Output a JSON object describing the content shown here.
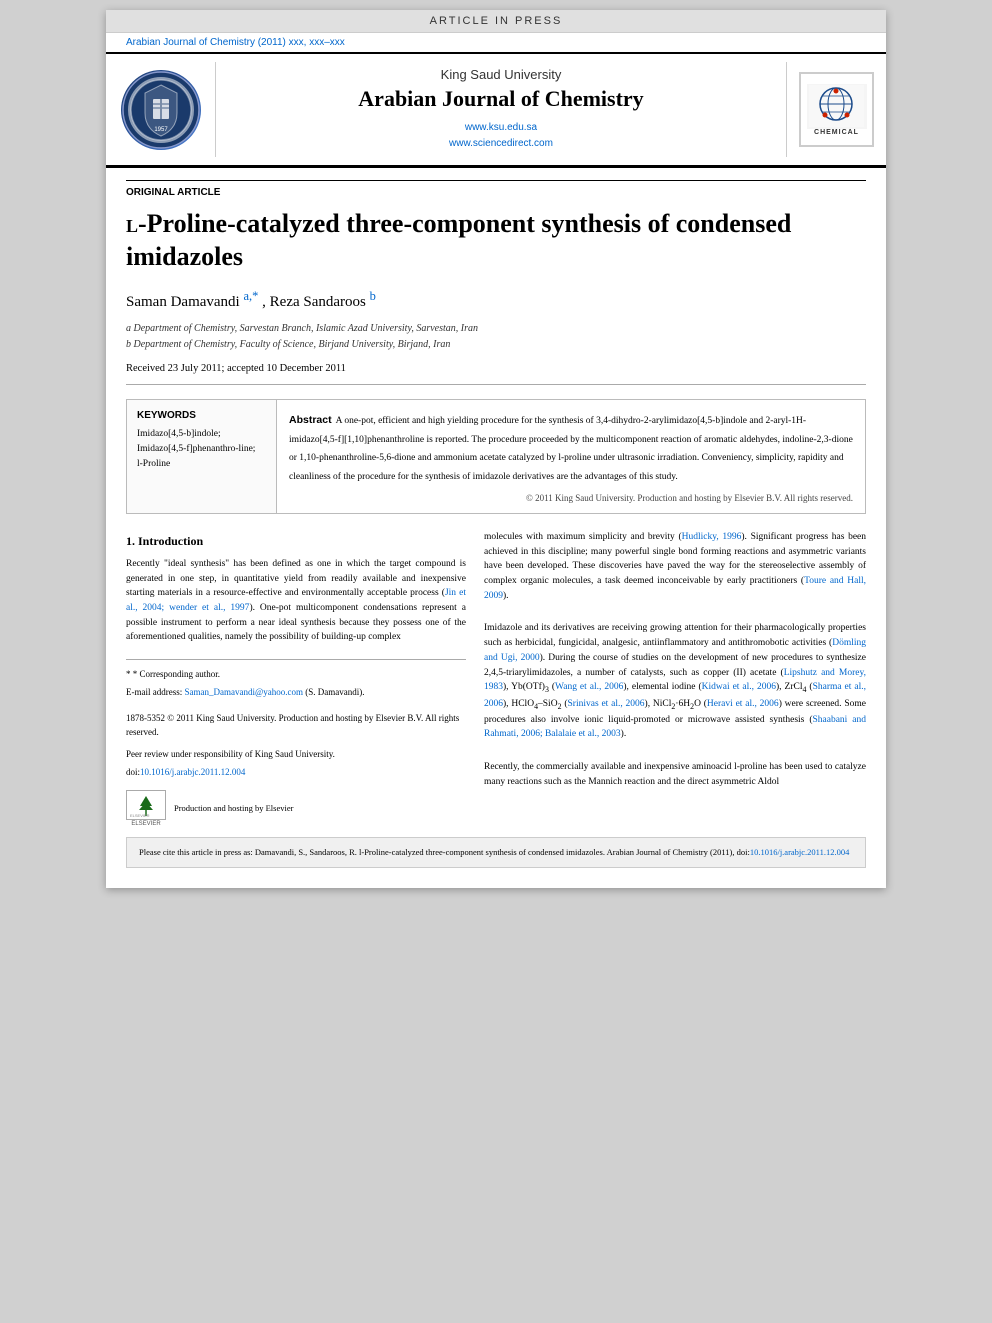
{
  "banner": {
    "text": "ARTICLE IN PRESS"
  },
  "journal_citation": "Arabian Journal of Chemistry (2011) xxx, xxx–xxx",
  "header": {
    "university": "King Saud University",
    "journal_title": "Arabian Journal of Chemistry",
    "url1": "www.ksu.edu.sa",
    "url2": "www.sciencedirect.com"
  },
  "article": {
    "type_label": "ORIGINAL ARTICLE",
    "title_prefix": "L",
    "title_main": "-Proline-catalyzed three-component synthesis of condensed imidazoles",
    "authors": "Saman Damavandi",
    "author_sup1": "a,*",
    "author2": ", Reza Sandaroos",
    "author_sup2": "b",
    "affiliation_a": "a Department of Chemistry, Sarvestan Branch, Islamic Azad University, Sarvestan, Iran",
    "affiliation_b": "b Department of Chemistry, Faculty of Science, Birjand University, Birjand, Iran",
    "dates": "Received 23 July 2011; accepted 10 December 2011",
    "keywords_title": "KEYWORDS",
    "keywords": [
      "Imidazo[4,5-b]indole;",
      "Imidazo[4,5-f]phenanthro-line;",
      "l-Proline"
    ],
    "abstract_title": "Abstract",
    "abstract_text": "  A one-pot, efficient and high yielding procedure for the synthesis of 3,4-dihydro-2-arylimidazo[4,5-b]indole and 2-aryl-1H-imidazo[4,5-f][1,10]phenanthroline is reported. The procedure proceeded by the multicomponent reaction of aromatic aldehydes, indoline-2,3-dione or 1,10-phenanthroline-5,6-dione and ammonium acetate catalyzed by l-proline under ultrasonic irradiation. Conveniency, simplicity, rapidity and cleanliness of the procedure for the synthesis of imidazole derivatives are the advantages of this study.",
    "abstract_copyright": "© 2011 King Saud University. Production and hosting by Elsevier B.V. All rights reserved.",
    "section1_title": "1. Introduction",
    "section1_col_left": "Recently \"ideal synthesis\" has been defined as one in which the target compound is generated in one step, in quantitative yield from readily available and inexpensive starting materials in a resource-effective and environmentally acceptable process (Jin et al., 2004; wender et al., 1997). One-pot multicomponent condensations represent a possible instrument to perform a near ideal synthesis because they possess one of the aforementioned qualities, namely the possibility of building-up complex",
    "section1_col_right_p1": "molecules with maximum simplicity and brevity (Hudlicky, 1996). Significant progress has been achieved in this discipline; many powerful single bond forming reactions and asymmetric variants have been developed. These discoveries have paved the way for the stereoselective assembly of complex organic molecules, a task deemed inconceivable by early practitioners (Toure and Hall, 2009).",
    "section1_col_right_p2": "Imidazole and its derivatives are receiving growing attention for their pharmacologically properties such as herbicidal, fungicidal, analgesic, antiinflammatory and antithromobotic activities (Dömling and Ugi, 2000). During the course of studies on the development of new procedures to synthesize 2,4,5-triarylimidazoles, a number of catalysts, such as copper (II) acetate (Lipshutz and Morey, 1983), Yb(OTf)3 (Wang et al., 2006), elemental iodine (Kidwai et al., 2006), ZrCl4 (Sharma et al., 2006), HClO4–SiO2 (Srinivas et al., 2006), NiCl2·6H2O (Heravi et al., 2006) were screened. Some procedures also involve ionic liquid-promoted or microwave assisted synthesis (Shaabani and Rahmati, 2006; Balalaie et al., 2003).",
    "section1_col_right_p3": "Recently, the commercially available and inexpensive aminoacid l-proline has been used to catalyze many reactions such as the Mannich reaction and the direct asymmetric Aldol",
    "footnote_star": "* Corresponding author.",
    "footnote_email_label": "E-mail address:",
    "footnote_email": "Saman_Damavandi@yahoo.com",
    "footnote_email_suffix": "(S. Damavandi).",
    "footnote_issn": "1878-5352 © 2011 King Saud University. Production and hosting by Elsevier B.V. All rights reserved.",
    "footnote_peer": "Peer review under responsibility of King Saud University.",
    "footnote_doi": "doi:10.1016/j.arabjc.2011.12.004",
    "footnote_elsevier_desc": "Production and hosting by Elsevier",
    "bottom_cite_label": "Please cite this article in press as: Damavandi, S., Sandaroos, R. l-Proline-catalyzed three-component synthesis  of condensed imidazoles. Arabian Journal of Chemistry (2011), doi:",
    "bottom_cite_doi": "10.1016/j.arabjc.2011.12.004"
  }
}
